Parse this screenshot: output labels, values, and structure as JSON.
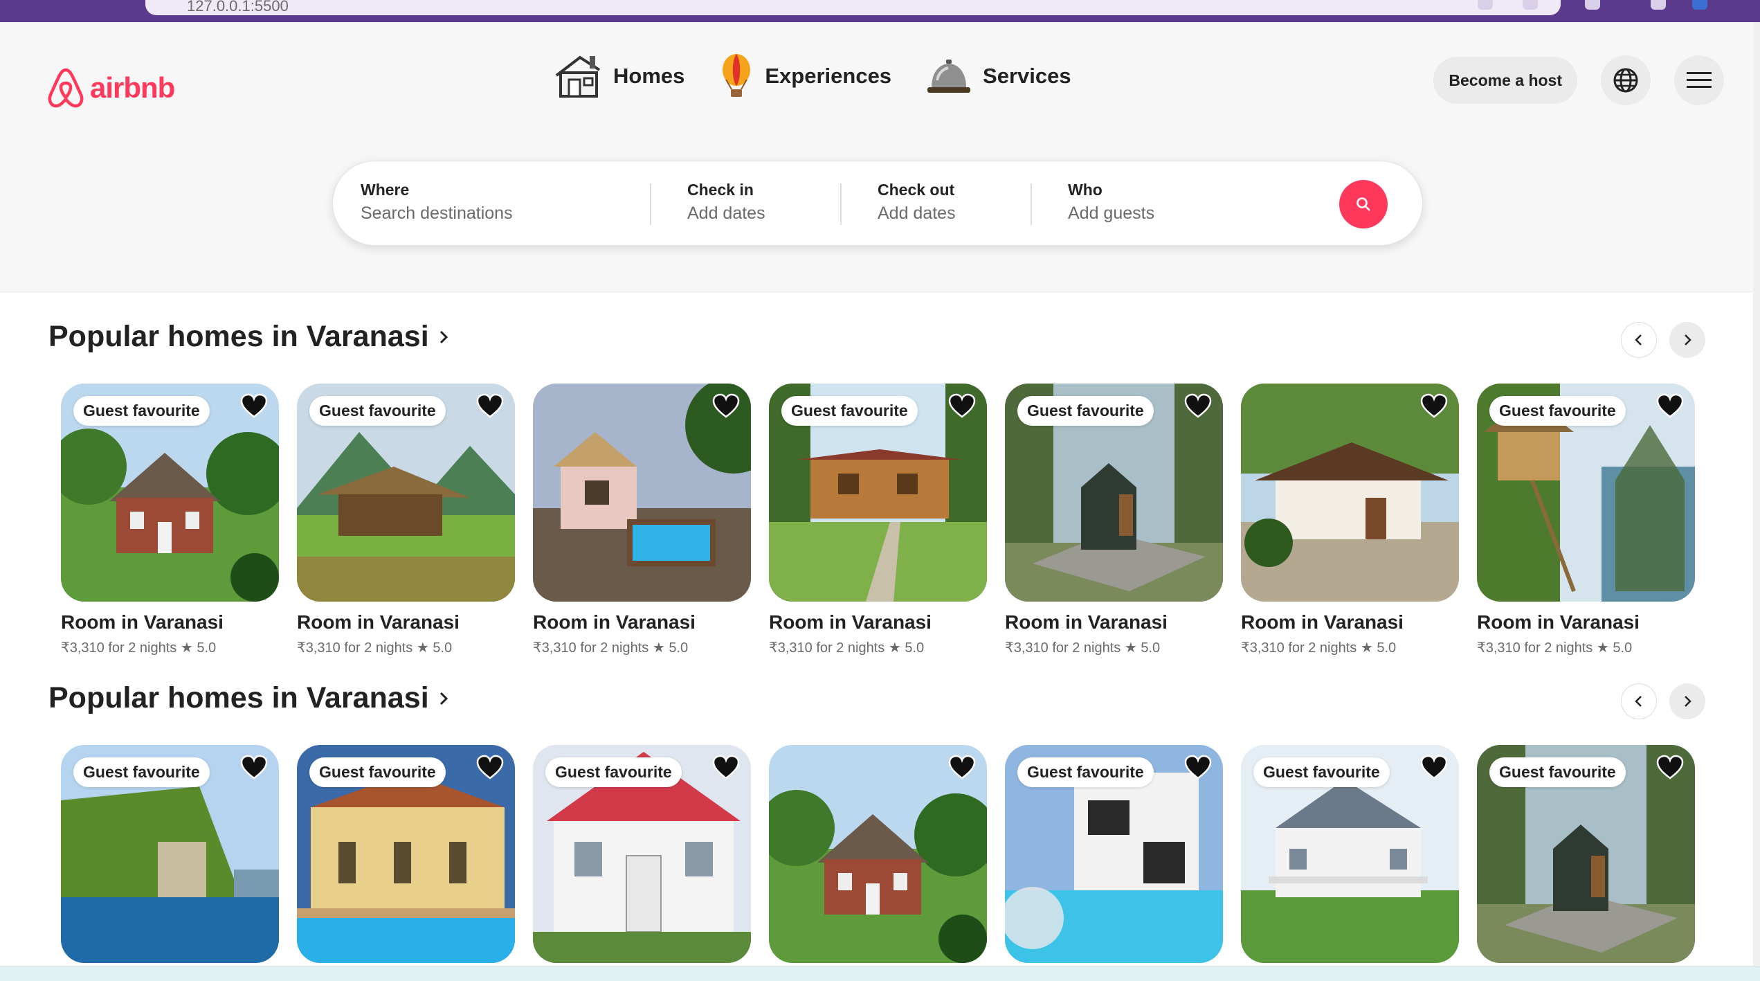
{
  "browser": {
    "url": "127.0.0.1:5500"
  },
  "brand": {
    "name": "airbnb",
    "color": "#ff385c"
  },
  "nav": [
    {
      "label": "Homes",
      "icon": "house-icon"
    },
    {
      "label": "Experiences",
      "icon": "hot-air-balloon-icon"
    },
    {
      "label": "Services",
      "icon": "service-bell-icon"
    }
  ],
  "header": {
    "host_label": "Become a host",
    "globe_icon": "globe-icon",
    "menu_icon": "hamburger-menu-icon"
  },
  "search": {
    "where": {
      "label": "Where",
      "placeholder": "Search destinations"
    },
    "checkin": {
      "label": "Check in",
      "placeholder": "Add dates"
    },
    "checkout": {
      "label": "Check out",
      "placeholder": "Add dates"
    },
    "who": {
      "label": "Who",
      "placeholder": "Add guests"
    }
  },
  "sections": [
    {
      "title": "Popular homes in Varanasi",
      "cards": [
        {
          "badge": "Guest favourite",
          "title": "Room in Varanasi",
          "sub": "₹3,310 for 2 nights ★ 5.0",
          "scene": "brick-house"
        },
        {
          "badge": "Guest favourite",
          "title": "Room in Varanasi",
          "sub": "₹3,310 for 2 nights ★ 5.0",
          "scene": "hut-mountains"
        },
        {
          "badge": "",
          "title": "Room in Varanasi",
          "sub": "₹3,310 for 2 nights ★ 5.0",
          "scene": "cottage-pool"
        },
        {
          "badge": "Guest favourite",
          "title": "Room in Varanasi",
          "sub": "₹3,310 for 2 nights ★ 5.0",
          "scene": "wood-cabin"
        },
        {
          "badge": "Guest favourite",
          "title": "Room in Varanasi",
          "sub": "₹3,310 for 2 nights ★ 5.0",
          "scene": "black-cabin"
        },
        {
          "badge": "",
          "title": "Room in Varanasi",
          "sub": "₹3,310 for 2 nights ★ 5.0",
          "scene": "thatched-house"
        },
        {
          "badge": "Guest favourite",
          "title": "Room in Varanasi",
          "sub": "₹3,310 for 2 nights ★ 5.0",
          "scene": "treehouse-coast"
        }
      ]
    },
    {
      "title": "Popular homes in Varanasi",
      "cards": [
        {
          "badge": "Guest favourite",
          "scene": "lake-villa"
        },
        {
          "badge": "Guest favourite",
          "scene": "yellow-villa-pool"
        },
        {
          "badge": "Guest favourite",
          "scene": "white-red-house"
        },
        {
          "badge": "",
          "scene": "brick-house"
        },
        {
          "badge": "Guest favourite",
          "scene": "modern-pool"
        },
        {
          "badge": "Guest favourite",
          "scene": "farmhouse"
        },
        {
          "badge": "Guest favourite",
          "scene": "black-cabin"
        }
      ]
    }
  ]
}
